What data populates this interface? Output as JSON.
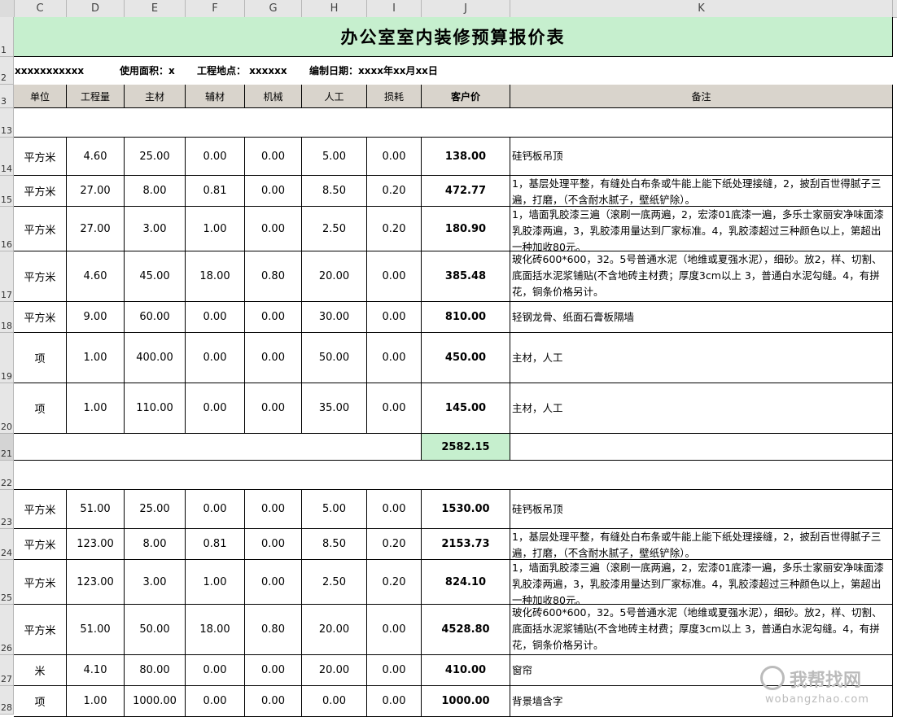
{
  "columns": [
    "C",
    "D",
    "E",
    "F",
    "G",
    "H",
    "I",
    "J",
    "K"
  ],
  "row_numbers": {
    "r1": "1",
    "r2": "2",
    "r3": "3",
    "r13": "13",
    "r14": "14",
    "r15": "15",
    "r16": "16",
    "r17": "17",
    "r18": "18",
    "r19": "19",
    "r20": "20",
    "r21": "21",
    "r22": "22",
    "r23": "23",
    "r24": "24",
    "r25": "25",
    "r26": "26",
    "r27": "27",
    "r28": "28"
  },
  "title": "办公室室内装修预算报价表",
  "info": {
    "client": "xxxxxxxxxxx",
    "area": "使用面积：x",
    "location": "工程地点：  xxxxxx",
    "date": "编制日期：xxxx年xx月xx日"
  },
  "headers": [
    "单位",
    "工程量",
    "主材",
    "辅材",
    "机械",
    "人工",
    "损耗",
    "客户价",
    "备注"
  ],
  "section1": [
    [
      "平方米",
      "4.60",
      "25.00",
      "0.00",
      "0.00",
      "5.00",
      "0.00",
      "138.00",
      "硅钙板吊顶"
    ],
    [
      "平方米",
      "27.00",
      "8.00",
      "0.81",
      "0.00",
      "8.50",
      "0.20",
      "472.77",
      "1，基层处理平整，有缝处白布条或牛能上能下纸处理接缝，2，披刮百世得腻子三遍，打磨，（不含耐水腻子，壁纸铲除）。"
    ],
    [
      "平方米",
      "27.00",
      "3.00",
      "1.00",
      "0.00",
      "2.50",
      "0.20",
      "180.90",
      "1，墙面乳胶漆三遍（滚刷一底两遍，2，宏漆01底漆一遍，多乐士家丽安净味面漆乳胶漆两遍，3，乳胶漆用量达到厂家标准。4，乳胶漆超过三种颜色以上，第超出一种加收80元。"
    ],
    [
      "平方米",
      "4.60",
      "45.00",
      "18.00",
      "0.80",
      "20.00",
      "0.00",
      "385.48",
      "玻化砖600*600，32。5号普通水泥（地维或夏强水泥），细砂。放2，样、切割、底面括水泥浆铺贴(不含地砖主材费；厚度3cm以上 3，普通白水泥勾缝。4，有拼花，铜条价格另计。"
    ],
    [
      "平方米",
      "9.00",
      "60.00",
      "0.00",
      "0.00",
      "30.00",
      "0.00",
      "810.00",
      "轻钢龙骨、纸面石膏板隔墙"
    ],
    [
      "项",
      "1.00",
      "400.00",
      "0.00",
      "0.00",
      "50.00",
      "0.00",
      "450.00",
      "主材，人工"
    ],
    [
      "项",
      "1.00",
      "110.00",
      "0.00",
      "0.00",
      "35.00",
      "0.00",
      "145.00",
      "主材，人工"
    ]
  ],
  "subtotal": "2582.15",
  "section2": [
    [
      "平方米",
      "51.00",
      "25.00",
      "0.00",
      "0.00",
      "5.00",
      "0.00",
      "1530.00",
      "硅钙板吊顶"
    ],
    [
      "平方米",
      "123.00",
      "8.00",
      "0.81",
      "0.00",
      "8.50",
      "0.20",
      "2153.73",
      "1，基层处理平整，有缝处白布条或牛能上能下纸处理接缝，2，披刮百世得腻子三遍，打磨，（不含耐水腻子，壁纸铲除）。"
    ],
    [
      "平方米",
      "123.00",
      "3.00",
      "1.00",
      "0.00",
      "2.50",
      "0.20",
      "824.10",
      "1，墙面乳胶漆三遍（滚刷一底两遍，2，宏漆01底漆一遍，多乐士家丽安净味面漆乳胶漆两遍，3，乳胶漆用量达到厂家标准。4，乳胶漆超过三种颜色以上，第超出一种加收80元。"
    ],
    [
      "平方米",
      "51.00",
      "50.00",
      "18.00",
      "0.80",
      "20.00",
      "0.00",
      "4528.80",
      "玻化砖600*600，32。5号普通水泥（地维或夏强水泥），细砂。放2，样、切割、底面括水泥浆铺贴(不含地砖主材费；厚度3cm以上 3，普通白水泥勾缝。4，有拼花，铜条价格另计。"
    ],
    [
      "米",
      "4.10",
      "80.00",
      "0.00",
      "0.00",
      "20.00",
      "0.00",
      "410.00",
      "窗帘"
    ],
    [
      "项",
      "1.00",
      "1000.00",
      "0.00",
      "0.00",
      "0.00",
      "0.00",
      "1000.00",
      "背景墙含字"
    ]
  ],
  "watermark": {
    "cn": "我帮找网",
    "url": "wobangzhao.com"
  },
  "colors": {
    "title_bg": "#c6efce",
    "header_bg": "#d9d4cc",
    "subtotal_bg": "#c6efce"
  }
}
